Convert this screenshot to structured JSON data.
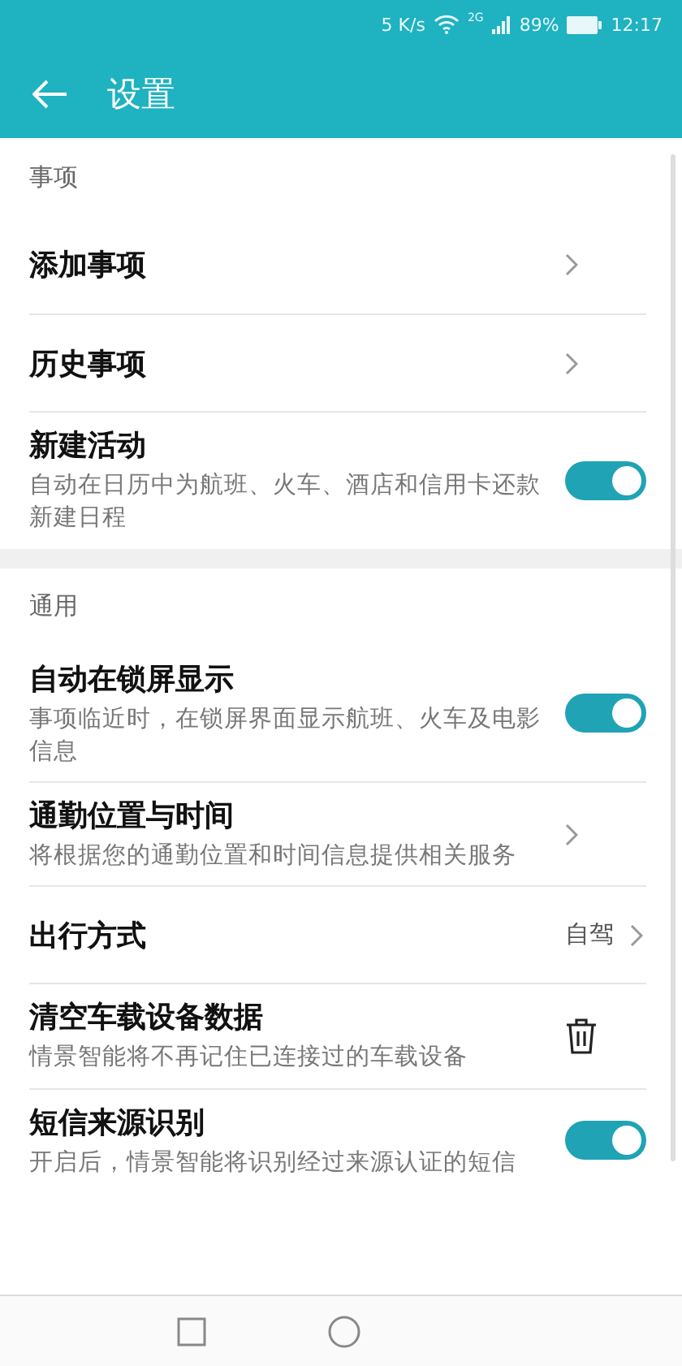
{
  "status_bar": {
    "speed": "5 K/s",
    "network": "2G",
    "battery": "89%",
    "time": "12:17"
  },
  "header": {
    "title": "设置"
  },
  "sections": [
    {
      "title": "事项",
      "items": [
        {
          "kind": "link",
          "title": "添加事项"
        },
        {
          "kind": "link",
          "title": "历史事项"
        },
        {
          "kind": "switch",
          "title": "新建活动",
          "subtitle": "自动在日历中为航班、火车、酒店和信用卡还款新建日程",
          "on": true
        }
      ]
    },
    {
      "title": "通用",
      "items": [
        {
          "kind": "switch",
          "title": "自动在锁屏显示",
          "subtitle": "事项临近时，在锁屏界面显示航班、火车及电影信息",
          "on": true
        },
        {
          "kind": "link",
          "title": "通勤位置与时间",
          "subtitle": "将根据您的通勤位置和时间信息提供相关服务"
        },
        {
          "kind": "link",
          "title": "出行方式",
          "value": "自驾"
        },
        {
          "kind": "delete",
          "title": "清空车载设备数据",
          "subtitle": "情景智能将不再记住已连接过的车载设备"
        },
        {
          "kind": "switch",
          "title": "短信来源识别",
          "subtitle": "开启后，情景智能将识别经过来源认证的短信",
          "on": true
        }
      ]
    }
  ]
}
